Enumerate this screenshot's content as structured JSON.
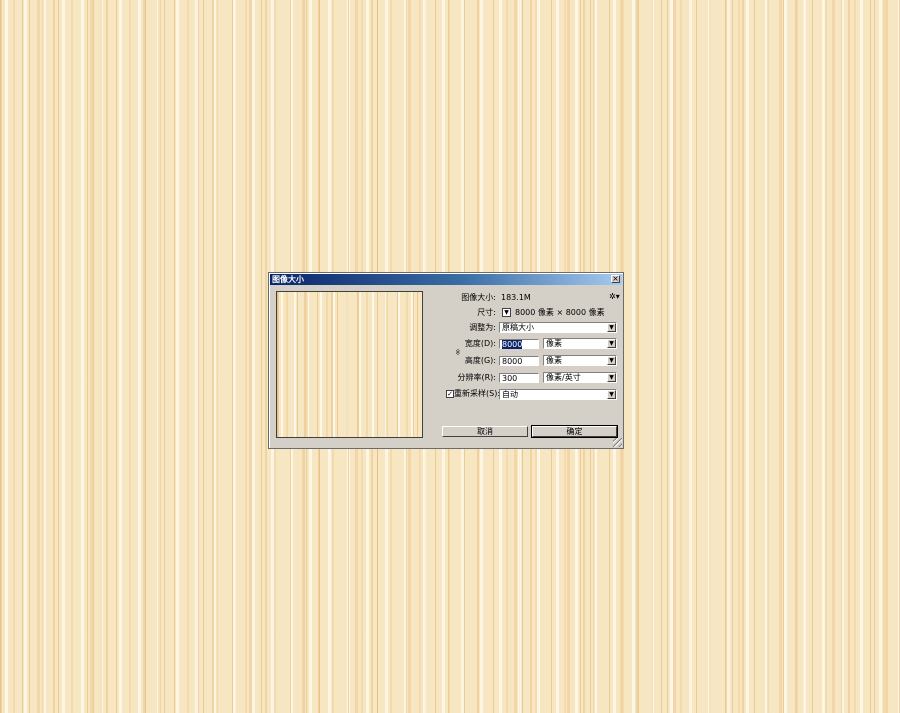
{
  "dialog": {
    "title": "图像大小",
    "image_size_label": "图像大小:",
    "image_size_value": "183.1M",
    "dimensions_label": "尺寸:",
    "dimensions_value": "8000 像素 × 8000 像素",
    "fit_to_label": "调整为:",
    "fit_to_value": "原稿大小",
    "width_label": "宽度(D):",
    "width_value": "8000",
    "width_unit": "像素",
    "height_label": "高度(G):",
    "height_value": "8000",
    "height_unit": "像素",
    "resolution_label": "分辨率(R):",
    "resolution_value": "300",
    "resolution_unit": "像素/英寸",
    "resample_label": "重新采样(S):",
    "resample_value": "自动",
    "resample_checked_glyph": "✓",
    "cancel_label": "取消",
    "ok_label": "确定",
    "close_glyph": "×",
    "dropdown_glyph": "▼",
    "gear_glyph": "✲▾",
    "chain_glyph": "∞"
  },
  "colors": {
    "title_bar_start": "#0a246a",
    "title_bar_end": "#a6caf0",
    "dialog_face": "#d4d0c8",
    "background_wood": "#f7e6c2"
  }
}
